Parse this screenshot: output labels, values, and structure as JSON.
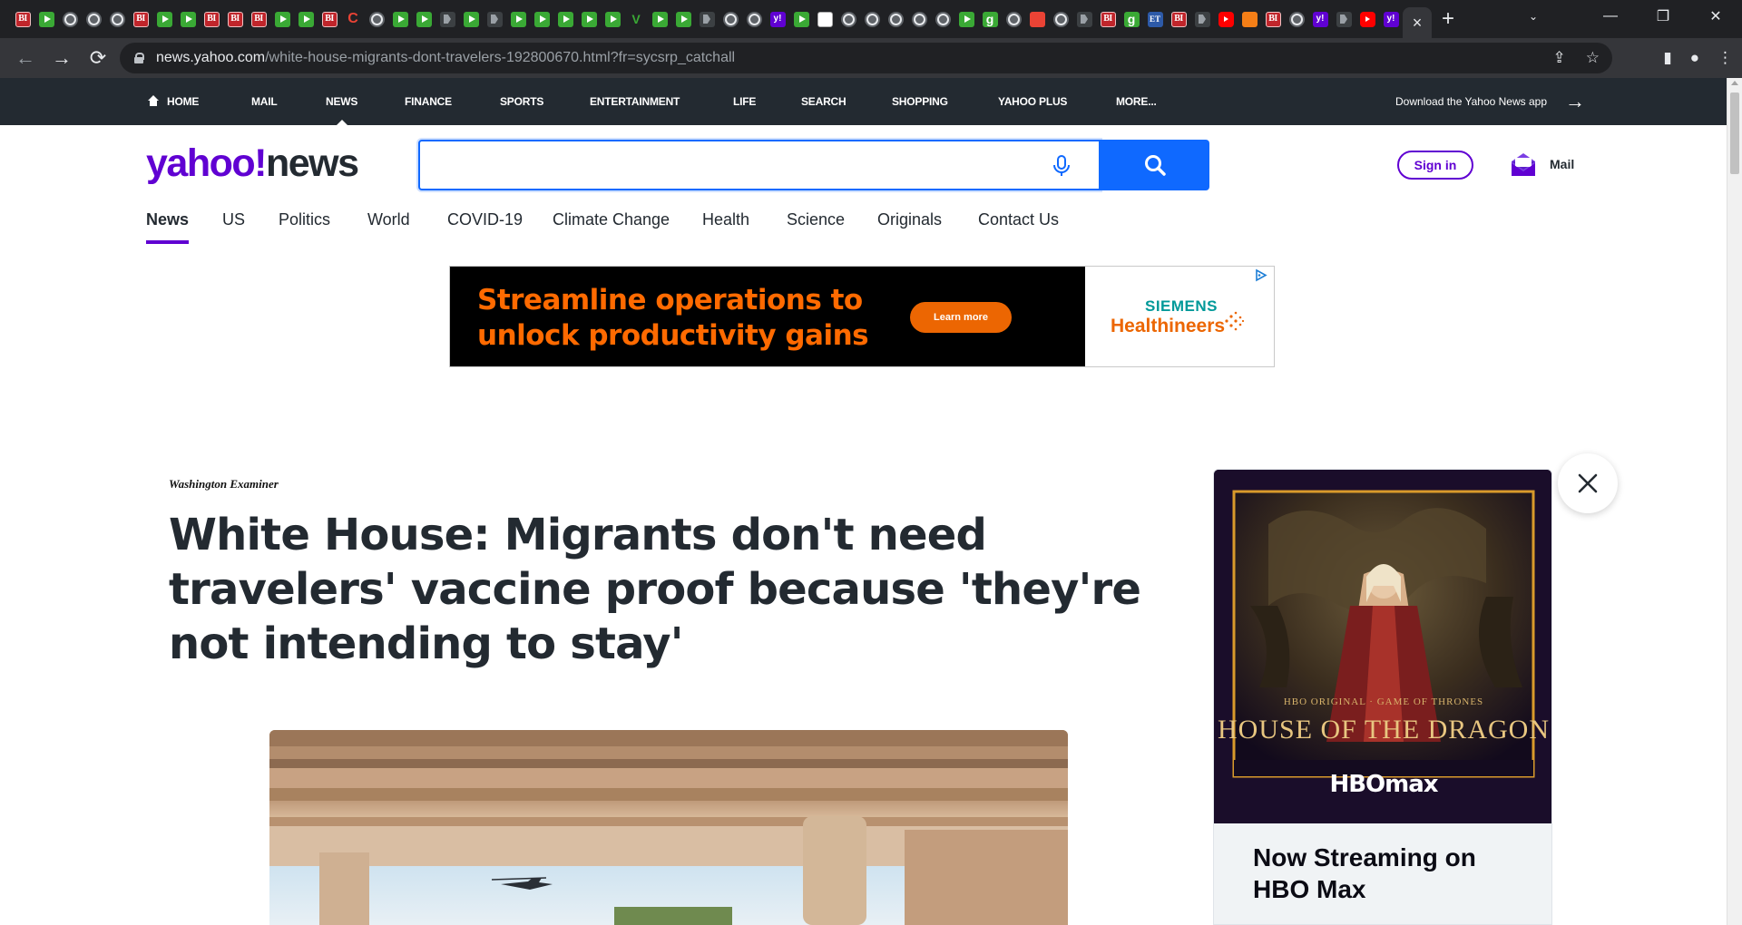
{
  "browser": {
    "tabs": [
      {
        "icon": "bi-icon",
        "glyph": "BI"
      },
      {
        "icon": "play-icon",
        "glyph": ""
      },
      {
        "icon": "globe-icon",
        "glyph": ""
      },
      {
        "icon": "globe-icon",
        "glyph": ""
      },
      {
        "icon": "globe-icon",
        "glyph": ""
      },
      {
        "icon": "bi-icon",
        "glyph": "BI"
      },
      {
        "icon": "play-icon",
        "glyph": ""
      },
      {
        "icon": "play-icon",
        "glyph": ""
      },
      {
        "icon": "bi-icon",
        "glyph": "BI"
      },
      {
        "icon": "bi-icon",
        "glyph": "BI"
      },
      {
        "icon": "bi-icon",
        "glyph": "BI"
      },
      {
        "icon": "play-icon",
        "glyph": ""
      },
      {
        "icon": "play-icon",
        "glyph": ""
      },
      {
        "icon": "bi-icon",
        "glyph": "BI"
      },
      {
        "icon": "c-icon",
        "glyph": "C"
      },
      {
        "icon": "globe-icon",
        "glyph": ""
      },
      {
        "icon": "play-icon",
        "glyph": ""
      },
      {
        "icon": "play-icon",
        "glyph": ""
      },
      {
        "icon": "dark-icon",
        "glyph": ""
      },
      {
        "icon": "play-icon",
        "glyph": ""
      },
      {
        "icon": "dark-icon",
        "glyph": ""
      },
      {
        "icon": "play-icon",
        "glyph": ""
      },
      {
        "icon": "play-icon",
        "glyph": ""
      },
      {
        "icon": "play-icon",
        "glyph": ""
      },
      {
        "icon": "play-icon",
        "glyph": ""
      },
      {
        "icon": "play-icon",
        "glyph": ""
      },
      {
        "icon": "v-icon",
        "glyph": "V"
      },
      {
        "icon": "play-icon",
        "glyph": ""
      },
      {
        "icon": "play-icon",
        "glyph": ""
      },
      {
        "icon": "dark-icon",
        "glyph": ""
      },
      {
        "icon": "globe-icon",
        "glyph": ""
      },
      {
        "icon": "globe-icon",
        "glyph": ""
      },
      {
        "icon": "yahoo-icon",
        "glyph": "y!"
      },
      {
        "icon": "play-icon",
        "glyph": ""
      },
      {
        "icon": "xls-icon",
        "glyph": ""
      },
      {
        "icon": "globe-icon",
        "glyph": ""
      },
      {
        "icon": "globe-icon",
        "glyph": ""
      },
      {
        "icon": "globe-icon",
        "glyph": ""
      },
      {
        "icon": "globe-icon",
        "glyph": ""
      },
      {
        "icon": "globe-icon",
        "glyph": ""
      },
      {
        "icon": "play-icon",
        "glyph": ""
      },
      {
        "icon": "g-icon",
        "glyph": "g"
      },
      {
        "icon": "globe-icon",
        "glyph": ""
      },
      {
        "icon": "red-icon",
        "glyph": ""
      },
      {
        "icon": "globe-icon",
        "glyph": ""
      },
      {
        "icon": "dark-icon",
        "glyph": ""
      },
      {
        "icon": "bi-icon",
        "glyph": "BI"
      },
      {
        "icon": "g-icon",
        "glyph": "g"
      },
      {
        "icon": "et-icon",
        "glyph": "ET"
      },
      {
        "icon": "bi-icon",
        "glyph": "BI"
      },
      {
        "icon": "dark-icon",
        "glyph": ""
      },
      {
        "icon": "youtube-icon",
        "glyph": ""
      },
      {
        "icon": "orange-icon",
        "glyph": ""
      },
      {
        "icon": "bi-icon",
        "glyph": "BI"
      },
      {
        "icon": "globe-icon",
        "glyph": ""
      },
      {
        "icon": "yahoo-icon",
        "glyph": "y!"
      },
      {
        "icon": "dark-icon",
        "glyph": ""
      },
      {
        "icon": "youtube-icon",
        "glyph": ""
      },
      {
        "icon": "yahoo-icon",
        "glyph": "y!"
      }
    ],
    "active_tab_close": "×",
    "new_tab": "+",
    "window_controls": {
      "tab_search": "⌄",
      "minimize": "—",
      "restore": "❐",
      "close": "✕"
    },
    "nav": {
      "back": "←",
      "forward": "→",
      "reload": "⟳"
    },
    "url_host": "news.yahoo.com",
    "url_path": "/white-house-migrants-dont-travelers-192800670.html?fr=sycsrp_catchall",
    "omnibox_icons": {
      "share": "⇪",
      "bookmark": "☆"
    },
    "toolbar_icons": {
      "sidepanel": "▮",
      "profile": "●",
      "menu": "⋮"
    }
  },
  "yahoo_top_nav": {
    "items": [
      "HOME",
      "MAIL",
      "NEWS",
      "FINANCE",
      "SPORTS",
      "ENTERTAINMENT",
      "LIFE",
      "SEARCH",
      "SHOPPING",
      "YAHOO PLUS",
      "MORE..."
    ],
    "active": "NEWS",
    "app_promo": "Download the Yahoo News app",
    "arrow": "→"
  },
  "header": {
    "logo_part1": "yahoo!",
    "logo_part2": "news",
    "search_value": "",
    "signin_label": "Sign in",
    "mail_label": "Mail"
  },
  "section_nav": {
    "items": [
      "News",
      "US",
      "Politics",
      "World",
      "COVID-19",
      "Climate Change",
      "Health",
      "Science",
      "Originals",
      "Contact Us"
    ],
    "active": "News"
  },
  "ad_banner": {
    "headline": "Streamline operations to unlock productivity gains",
    "cta": "Learn more",
    "brand_line1": "SIEMENS",
    "brand_line2": "Healthineers",
    "colors": {
      "orange": "#ff6a00",
      "teal": "#009999"
    }
  },
  "article": {
    "source": "Washington Examiner",
    "headline": "White House: Migrants don't need travelers' vaccine proof because 'they're not intending to stay'"
  },
  "side_ad": {
    "kicker": "HBO ORIGINAL · GAME OF THRONES",
    "title": "HOUSE OF THE DRAGON",
    "network": "HBOmax",
    "text": "Now Streaming on HBO Max",
    "close": "✕"
  },
  "colors": {
    "yahoo_purple": "#6001d2",
    "search_blue": "#0f69ff",
    "nav_dark": "#232a31"
  }
}
